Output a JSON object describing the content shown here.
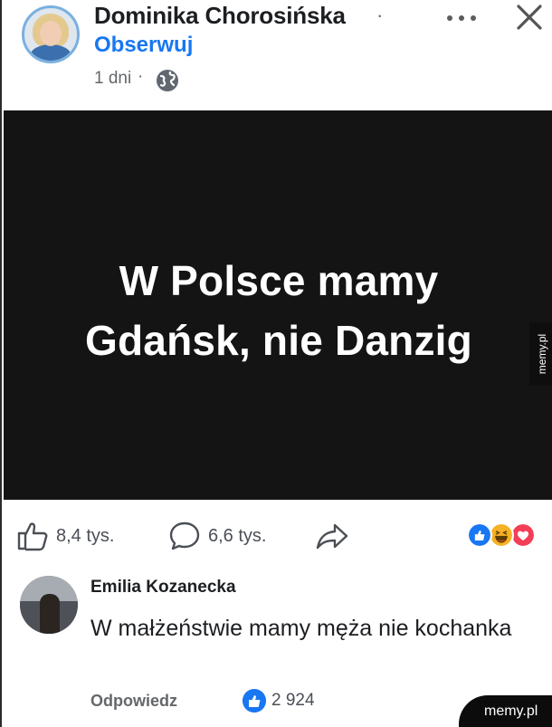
{
  "post": {
    "author": "Dominika Chorosińska",
    "author_separator": "·",
    "follow_label": "Obserwuj",
    "time": "1 dni",
    "time_separator": "·",
    "image_text_line1": "W Polsce mamy",
    "image_text_line2": "Gdańsk, nie Danzig",
    "image_watermark": "memy.pl"
  },
  "actions": {
    "likes": "8,4 tys.",
    "comments": "6,6 tys.",
    "reaction_icons": [
      "like-reaction",
      "haha-reaction",
      "love-reaction"
    ]
  },
  "comment": {
    "author": "Emilia Kozanecka",
    "text": "W małżeństwie mamy męża nie kochanka",
    "reply_label": "Odpowiedz",
    "likes": "2 924"
  },
  "watermark": {
    "corner_text": "memy.pl"
  },
  "colors": {
    "accent": "#1877f2",
    "image_background": "#141414",
    "secondary_text": "#65676b"
  }
}
